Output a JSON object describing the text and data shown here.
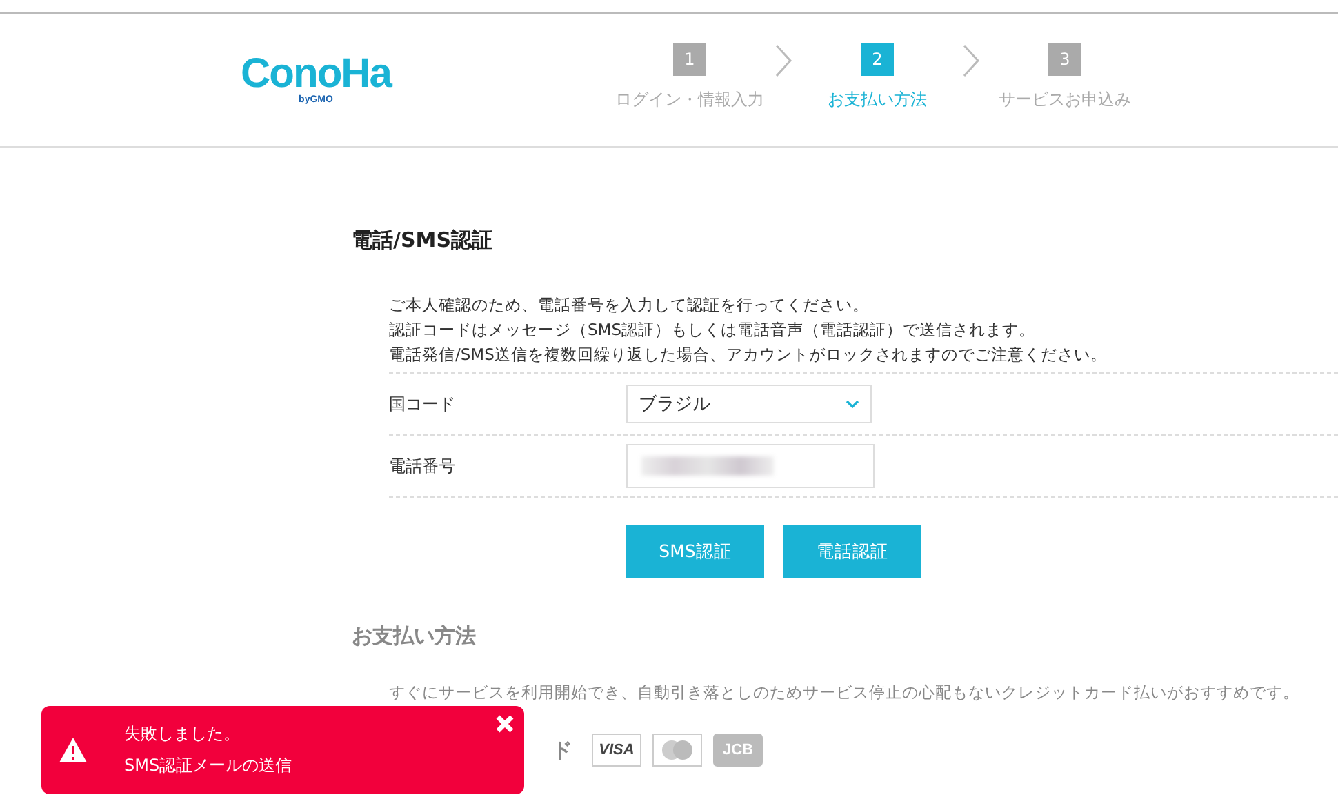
{
  "header": {
    "logo": {
      "main": "ConoHa",
      "sub": "byGMO"
    },
    "steps": [
      {
        "number": "1",
        "label": "ログイン・情報入力",
        "selected": false
      },
      {
        "number": "2",
        "label": "お支払い方法",
        "selected": true
      },
      {
        "number": "3",
        "label": "サービスお申込み",
        "selected": false
      }
    ]
  },
  "verification": {
    "title": "電話/SMS認証",
    "notes": [
      "ご本人確認のため、電話番号を入力して認証を行ってください。",
      "認証コードはメッセージ（SMS認証）もしくは電話音声（電話認証）で送信されます。",
      "電話発信/SMS送信を複数回繰り返した場合、アカウントがロックされますのでご注意ください。"
    ],
    "fields": [
      {
        "kind": "select",
        "label": "国コード",
        "value": "ブラジル"
      },
      {
        "kind": "redacted",
        "label": "電話番号"
      }
    ],
    "buttons": [
      "SMS認証",
      "電話認証"
    ]
  },
  "payment": {
    "title": "お支払い方法",
    "description": "すぐにサービスを利用開始でき、自動引き落としのためサービス停止の心配もないクレジットカード払いがおすすめです。",
    "card_heading": "ド",
    "cards": [
      {
        "kind": "label",
        "text": "VISA"
      },
      {
        "kind": "circles"
      },
      {
        "kind": "label",
        "text": "JCB"
      }
    ]
  },
  "toast": {
    "title": "失敗しました。",
    "message": "SMS認証メールの送信"
  }
}
